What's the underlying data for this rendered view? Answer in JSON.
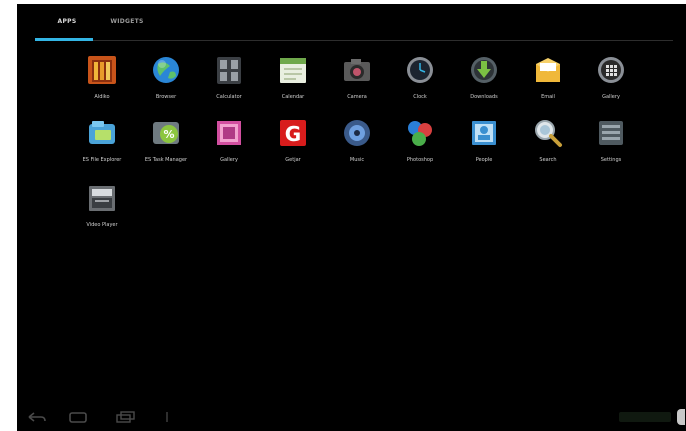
{
  "tabs": [
    {
      "label": "APPS",
      "selected": true
    },
    {
      "label": "WIDGETS",
      "selected": false
    }
  ],
  "apps": [
    {
      "label": "Aldiko",
      "icon": "aldiko-books-icon"
    },
    {
      "label": "Browser",
      "icon": "browser-globe-icon"
    },
    {
      "label": "Calculator",
      "icon": "calculator-icon"
    },
    {
      "label": "Calendar",
      "icon": "calendar-icon"
    },
    {
      "label": "Camera",
      "icon": "camera-icon"
    },
    {
      "label": "Clock",
      "icon": "clock-icon"
    },
    {
      "label": "Downloads",
      "icon": "downloads-icon"
    },
    {
      "label": "Email",
      "icon": "email-icon"
    },
    {
      "label": "Gallery",
      "icon": "gallery-icon"
    },
    {
      "label": "ES File Explorer",
      "icon": "es-file-explorer-icon"
    },
    {
      "label": "ES Task Manager",
      "icon": "es-task-manager-icon"
    },
    {
      "label": "Gallery",
      "icon": "photo-gallery-icon"
    },
    {
      "label": "Getjar",
      "icon": "getjar-icon"
    },
    {
      "label": "Music",
      "icon": "music-icon"
    },
    {
      "label": "Photoshop",
      "icon": "photoshop-express-icon"
    },
    {
      "label": "People",
      "icon": "people-icon"
    },
    {
      "label": "Search",
      "icon": "search-icon"
    },
    {
      "label": "Settings",
      "icon": "settings-icon"
    },
    {
      "label": "Video Player",
      "icon": "video-player-icon"
    }
  ],
  "colors": {
    "accent": "#33b5e5",
    "background": "#000000"
  }
}
